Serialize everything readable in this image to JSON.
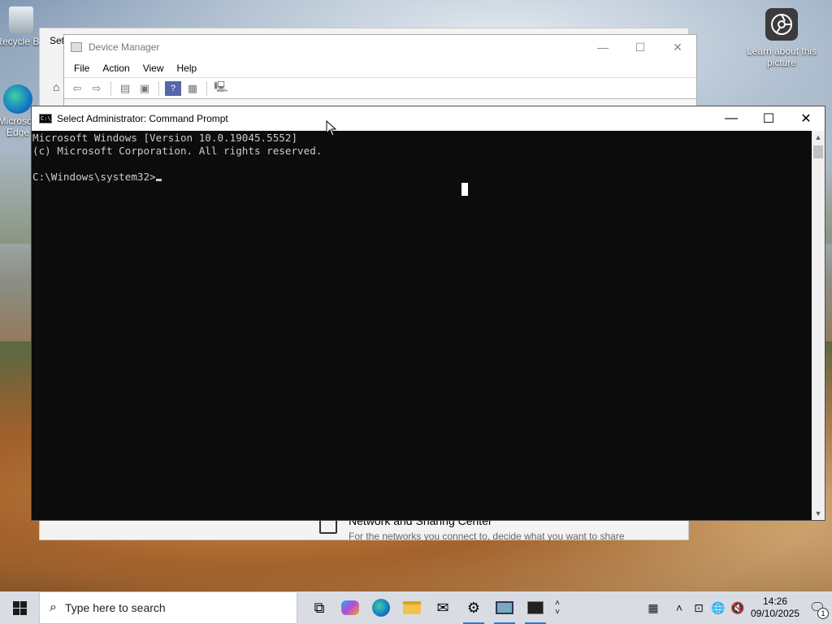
{
  "desktop": {
    "icons": [
      {
        "label": "Recycle Bin",
        "icon": "recycle-bin-icon"
      },
      {
        "label": "Microsoft Edge",
        "icon": "edge-icon"
      }
    ],
    "learn_about": {
      "label": "Learn about this picture",
      "icon": "camera-icon"
    }
  },
  "settings_window": {
    "title": "Settings",
    "network_sharing": {
      "title": "Network and Sharing Center",
      "description": "For the networks you connect to, decide what you want to share"
    }
  },
  "device_manager": {
    "title": "Device Manager",
    "menu": [
      "File",
      "Action",
      "View",
      "Help"
    ],
    "toolbar_icons": [
      "back-icon",
      "forward-icon",
      "properties-icon",
      "tree-icon",
      "help-icon",
      "view-icon",
      "monitor-icon"
    ]
  },
  "cmd": {
    "title": "Select Administrator: Command Prompt",
    "lines": [
      "Microsoft Windows [Version 10.0.19045.5552]",
      "(c) Microsoft Corporation. All rights reserved.",
      "",
      "C:\\Windows\\system32>"
    ]
  },
  "taskbar": {
    "search_placeholder": "Type here to search",
    "apps": [
      "task-view-icon",
      "copilot-icon",
      "edge-icon",
      "file-explorer-icon",
      "mail-icon",
      "settings-icon",
      "device-manager-icon",
      "cmd-icon"
    ],
    "clock_time": "14:26",
    "clock_date": "09/10/2025",
    "notification_count": "1"
  },
  "colors": {
    "console_bg": "#0c0c0c",
    "console_text": "#cccccc",
    "taskbar_bg": "#d9dde3",
    "accent": "#2b79d6"
  }
}
